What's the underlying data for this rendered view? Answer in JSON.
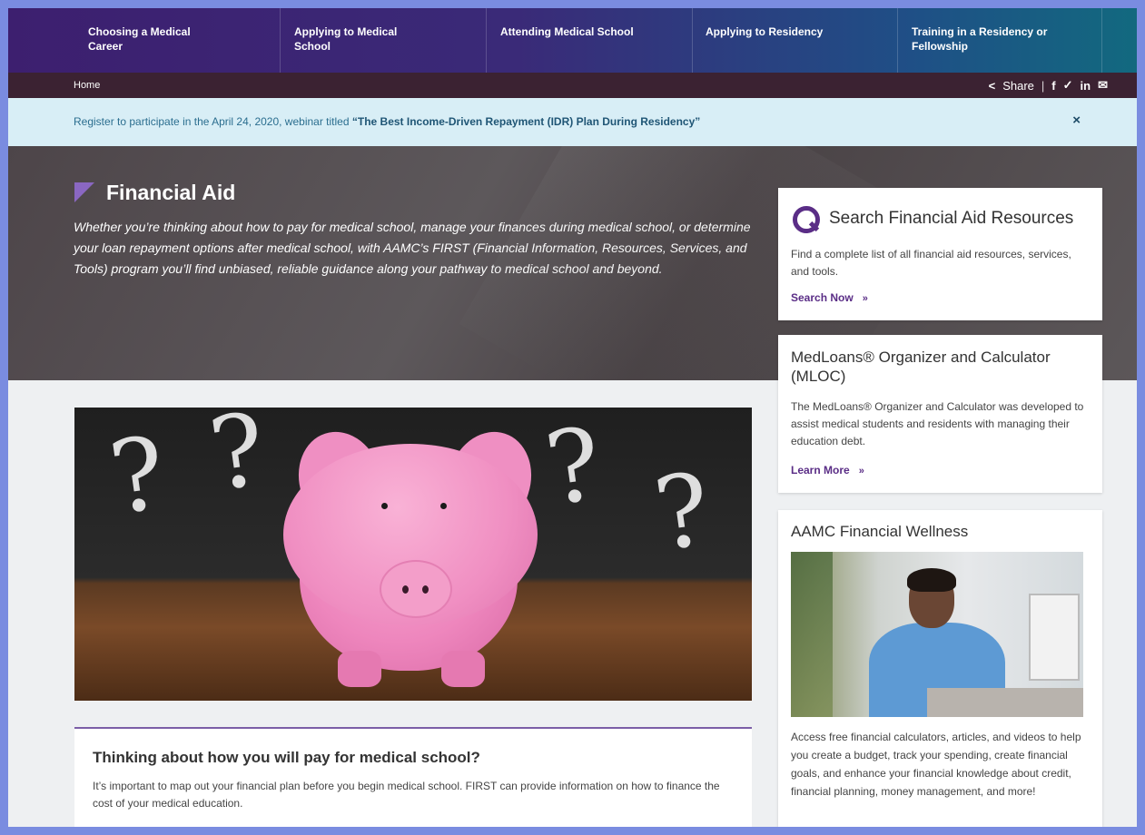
{
  "nav": {
    "items": [
      {
        "label": "Choosing a Medical Career"
      },
      {
        "label": "Applying to Medical School"
      },
      {
        "label": "Attending Medical School"
      },
      {
        "label": "Applying to Residency"
      },
      {
        "label": "Training in a Residency or Fellowship"
      }
    ]
  },
  "breadcrumb": {
    "home": "Home"
  },
  "share": {
    "label": "Share",
    "separator": "|",
    "icons": [
      "share-icon",
      "facebook-icon",
      "twitter-icon",
      "linkedin-icon",
      "email-icon"
    ]
  },
  "alert": {
    "prefix": "Register",
    "text": " to participate in the April 24, 2020, webinar titled ",
    "title": "“The Best Income-Driven Repayment (IDR) Plan During Residency”",
    "close": "×"
  },
  "hero": {
    "title": "Financial Aid",
    "description": "Whether you’re thinking about how to pay for medical school, manage your finances during medical school, or determine your loan repayment options after medical school, with AAMC’s FIRST (Financial Information, Resources, Services, and Tools) program you’ll find unbiased, reliable guidance along your pathway to medical school and beyond."
  },
  "cards": {
    "search": {
      "title": "Search Financial Aid Resources",
      "body": "Find a complete list of all financial aid resources, services, and tools.",
      "link": "Search Now",
      "arrow": "»"
    },
    "mloc": {
      "title": "MedLoans® Organizer and Calculator (MLOC)",
      "body": "The MedLoans® Organizer and Calculator was developed to assist medical students and residents with managing their education debt.",
      "link": "Learn More",
      "arrow": "»"
    },
    "wellness": {
      "title": "AAMC Financial Wellness",
      "body": "Access free financial calculators, articles, and videos to help you create a budget, track your spending, create financial goals, and enhance your financial knowledge about credit, financial planning, money management, and more!"
    }
  },
  "article": {
    "title": "Thinking about how you will pay for medical school?",
    "body": "It’s important to map out your financial plan before you begin medical school. FIRST can provide information on how to finance the cost of your medical education."
  },
  "colors": {
    "accent": "#5a2d86",
    "alert_bg": "#d8eef6",
    "hero_bg": "#4d4549"
  }
}
